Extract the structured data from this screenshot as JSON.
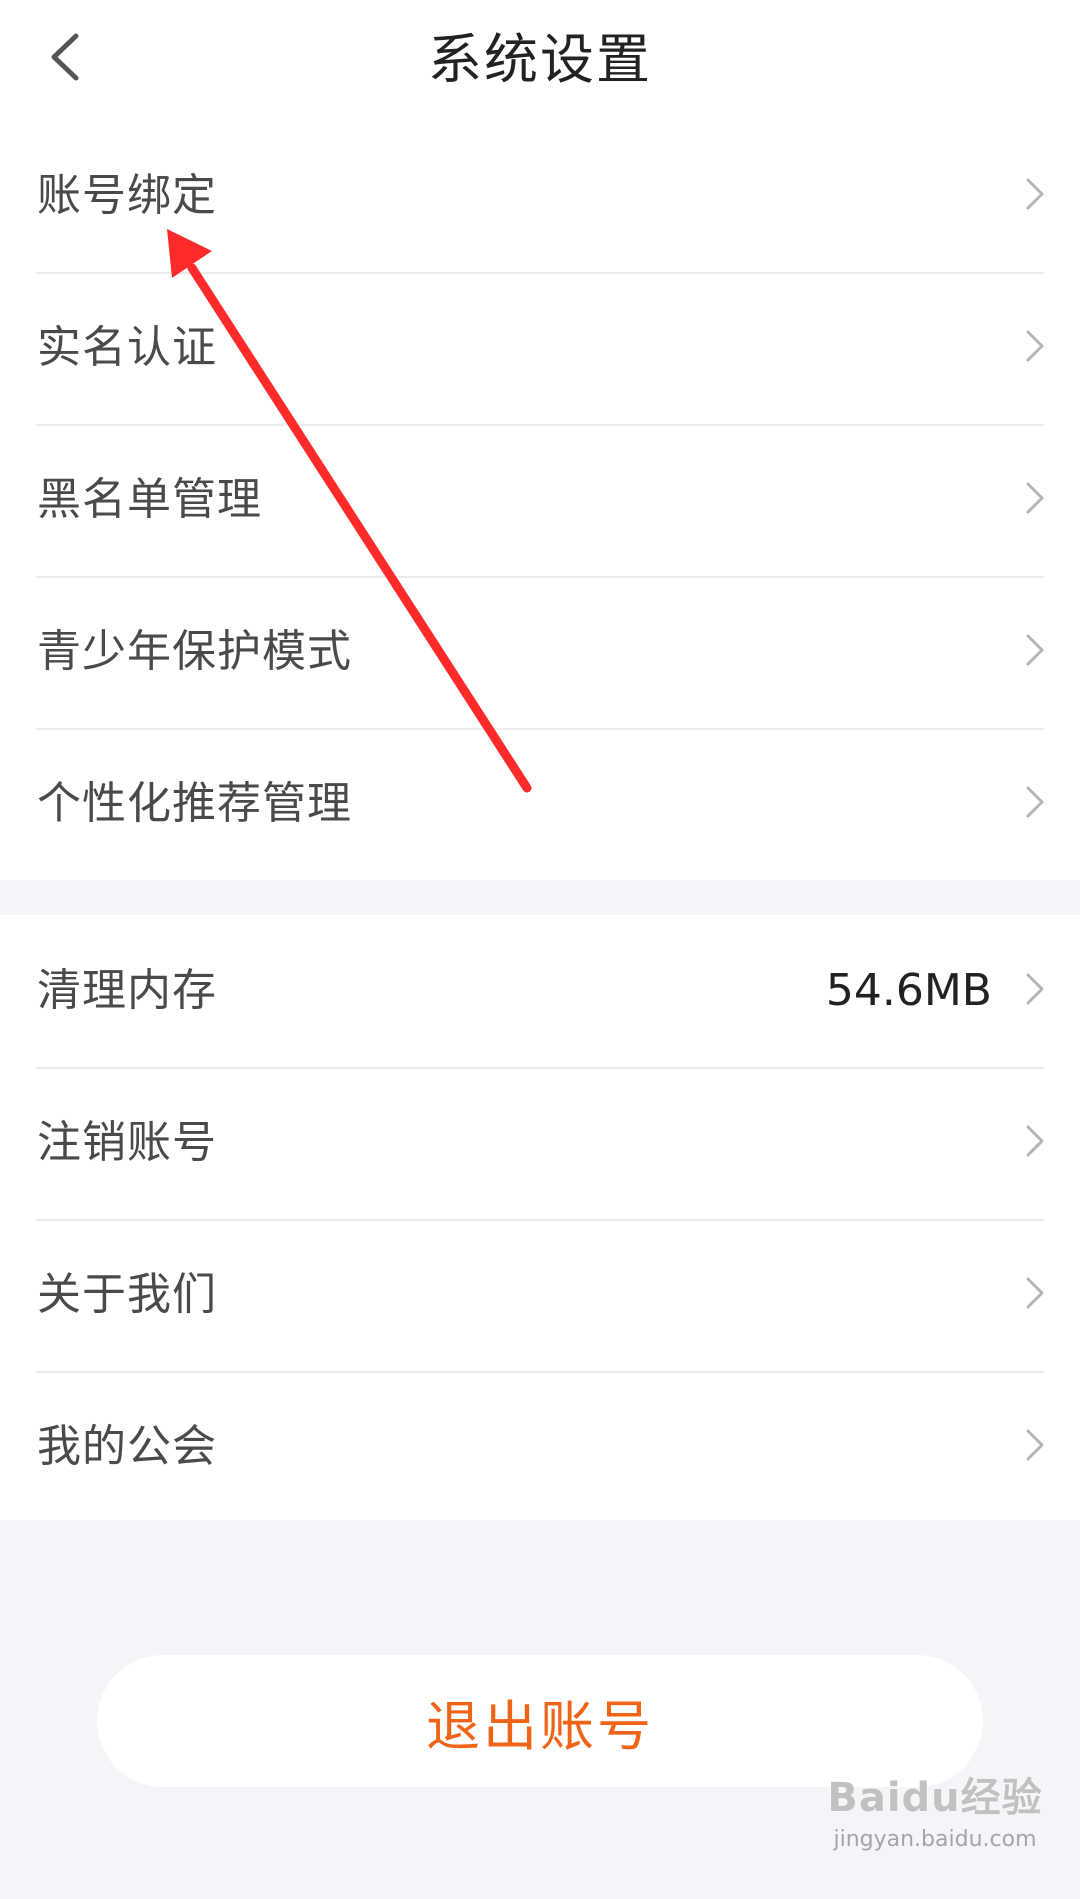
{
  "header": {
    "title": "系统设置",
    "back_icon": "chevron-left-icon"
  },
  "group1": {
    "items": [
      {
        "label": "账号绑定"
      },
      {
        "label": "实名认证"
      },
      {
        "label": "黑名单管理"
      },
      {
        "label": "青少年保护模式"
      },
      {
        "label": "个性化推荐管理"
      }
    ]
  },
  "group2": {
    "items": [
      {
        "label": "清理内存",
        "value": "54.6MB"
      },
      {
        "label": "注销账号"
      },
      {
        "label": "关于我们"
      },
      {
        "label": "我的公会"
      }
    ]
  },
  "logout": {
    "label": "退出账号"
  },
  "annotation": {
    "arrow_color": "#ff2a2a"
  },
  "watermark": {
    "logo": "Baidu经验",
    "sub": "jingyan.baidu.com"
  },
  "colors": {
    "logout_text": "#f06418",
    "background": "#f4f5f9"
  }
}
